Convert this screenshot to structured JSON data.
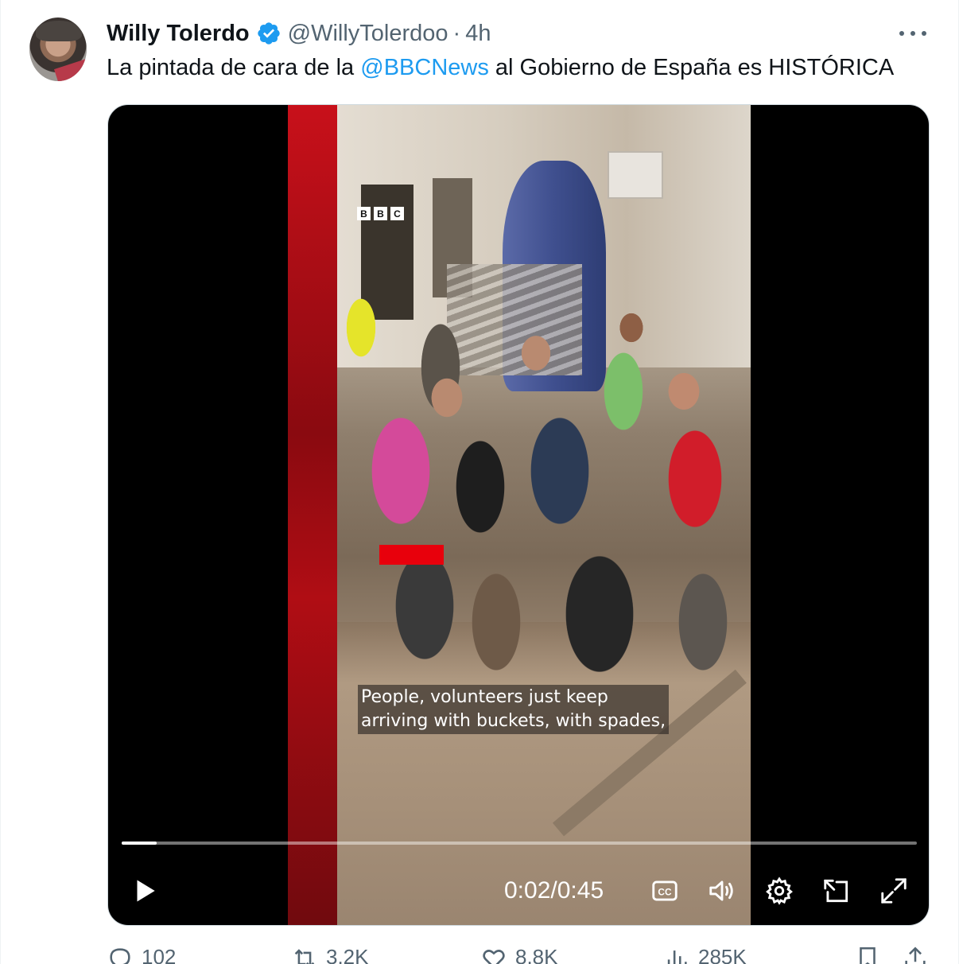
{
  "user": {
    "name": "Willy Tolerdo",
    "handle": "@WillyTolerdoo",
    "separator": "·",
    "time": "4h",
    "verified": true
  },
  "tweet": {
    "text_before": "La pintada de cara de la ",
    "mention": "@BBCNews",
    "text_after": " al Gobierno de España es HISTÓRICA"
  },
  "video": {
    "logo_letters": [
      "B",
      "B",
      "C"
    ],
    "caption_line1": "People, volunteers just keep",
    "caption_line2": "arriving with buckets, with spades,",
    "current_time": "0:02",
    "duration": "0:45",
    "time_separator": " / ",
    "progress_fraction": 0.044
  },
  "actions": {
    "replies": "102",
    "reposts": "3.2K",
    "likes": "8.8K",
    "views": "285K"
  },
  "colors": {
    "accent": "#1d9bf0",
    "text": "#0f1419",
    "secondary": "#536471"
  },
  "icons": {
    "verified": "verified-badge-icon",
    "more": "more-icon",
    "play": "play-icon",
    "captions": "captions-icon",
    "volume": "volume-icon",
    "settings": "gear-icon",
    "pip": "picture-in-picture-icon",
    "fullscreen": "fullscreen-icon",
    "reply": "reply-icon",
    "repost": "repost-icon",
    "like": "heart-icon",
    "views": "views-icon",
    "bookmark": "bookmark-icon",
    "share": "share-icon"
  }
}
